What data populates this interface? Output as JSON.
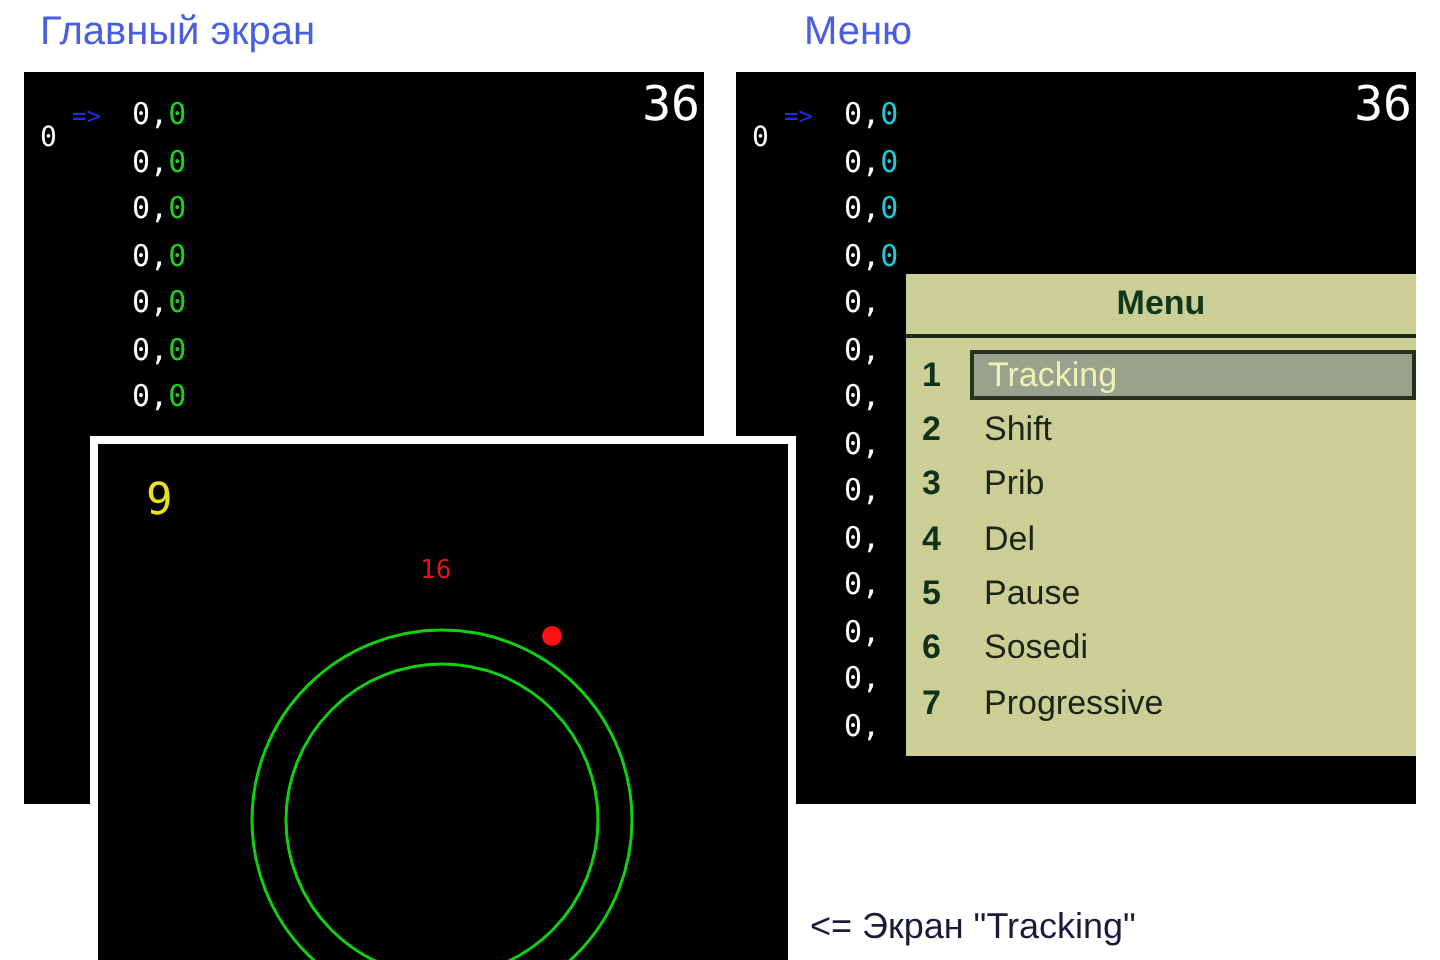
{
  "captions": [
    {
      "kind": "main",
      "text": "Главный экран"
    },
    {
      "kind": "menu",
      "text": "Меню"
    },
    {
      "kind": "tracking",
      "text": "<= Экран \"Tracking\""
    }
  ],
  "main_screen": {
    "cursor": "=>",
    "side_value": "0",
    "counter": "36",
    "rows": [
      {
        "a": "0,",
        "b": "0"
      },
      {
        "a": "0,",
        "b": "0"
      },
      {
        "a": "0,",
        "b": "0"
      },
      {
        "a": "0,",
        "b": "0"
      },
      {
        "a": "0,",
        "b": "0"
      },
      {
        "a": "0,",
        "b": "0"
      },
      {
        "a": "0,",
        "b": "0"
      }
    ]
  },
  "menu_screen": {
    "cursor": "=>",
    "side_value": "0",
    "counter": "36",
    "rows": [
      {
        "a": "0,",
        "b": "0"
      },
      {
        "a": "0,",
        "b": "0"
      },
      {
        "a": "0,",
        "b": "0"
      },
      {
        "a": "0,",
        "b": "0"
      },
      {
        "a": "0,"
      },
      {
        "a": "0,"
      },
      {
        "a": "0,"
      },
      {
        "a": "0,"
      },
      {
        "a": "0,"
      },
      {
        "a": "0,"
      },
      {
        "a": "0,"
      },
      {
        "a": "0,"
      },
      {
        "a": "0,"
      },
      {
        "a": "0,"
      }
    ],
    "menu": {
      "title": "Menu",
      "items": [
        {
          "number": "1",
          "label": "Tracking",
          "selected": true
        },
        {
          "number": "2",
          "label": "Shift",
          "selected": false
        },
        {
          "number": "3",
          "label": "Prib",
          "selected": false
        },
        {
          "number": "4",
          "label": "Del",
          "selected": false
        },
        {
          "number": "5",
          "label": "Pause",
          "selected": false
        },
        {
          "number": "6",
          "label": "Sosedi",
          "selected": false
        },
        {
          "number": "7",
          "label": "Progressive",
          "selected": false
        }
      ]
    }
  },
  "tracking_screen": {
    "count": "9",
    "ring_label": "16"
  }
}
